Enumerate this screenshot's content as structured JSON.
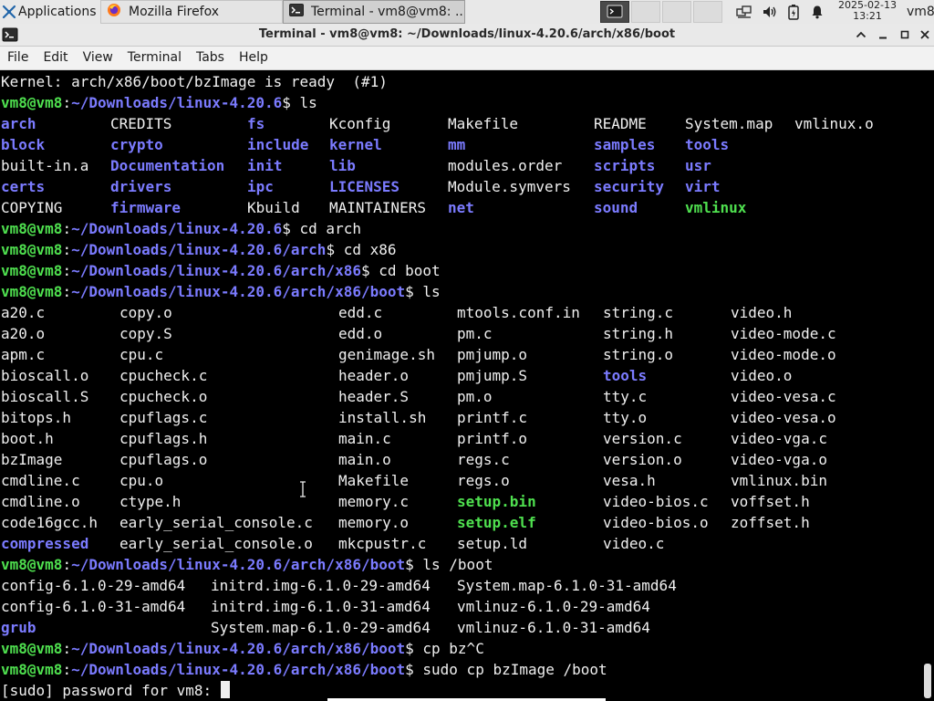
{
  "panel": {
    "apps_label": "Applications",
    "tasks": [
      {
        "label": "Mozilla Firefox"
      },
      {
        "label": "Terminal - vm8@vm8: ..."
      }
    ],
    "clock_date": "2025-02-13",
    "clock_time": "13:21",
    "user": "vm8"
  },
  "window": {
    "title": "Terminal - vm8@vm8: ~/Downloads/linux-4.20.6/arch/x86/boot"
  },
  "menubar": [
    "File",
    "Edit",
    "View",
    "Terminal",
    "Tabs",
    "Help"
  ],
  "terminal": {
    "lines": [
      {
        "segments": [
          {
            "t": "Kernel: arch/x86/boot/bzImage is ready  (#1)",
            "s": ""
          }
        ]
      },
      {
        "segments": [
          {
            "t": "vm8@vm8",
            "s": "g"
          },
          {
            "t": ":",
            "s": ""
          },
          {
            "t": "~/Downloads/linux-4.20.6",
            "s": "b"
          },
          {
            "t": "$ ls",
            "s": ""
          }
        ]
      },
      {
        "cols": [
          [
            0,
            "arch",
            "b"
          ],
          [
            120,
            "CREDITS",
            ""
          ],
          [
            270,
            "fs",
            "b"
          ],
          [
            360,
            "Kconfig",
            ""
          ],
          [
            490,
            "Makefile",
            ""
          ],
          [
            650,
            "README",
            ""
          ],
          [
            750,
            "System.map",
            ""
          ],
          [
            870,
            "vmlinux.o",
            ""
          ]
        ]
      },
      {
        "cols": [
          [
            0,
            "block",
            "b"
          ],
          [
            120,
            "crypto",
            "b"
          ],
          [
            270,
            "include",
            "b"
          ],
          [
            360,
            "kernel",
            "b"
          ],
          [
            490,
            "mm",
            "b"
          ],
          [
            650,
            "samples",
            "b"
          ],
          [
            750,
            "tools",
            "b"
          ]
        ]
      },
      {
        "cols": [
          [
            0,
            "built-in.a",
            ""
          ],
          [
            120,
            "Documentation",
            "b"
          ],
          [
            270,
            "init",
            "b"
          ],
          [
            360,
            "lib",
            "b"
          ],
          [
            490,
            "modules.order",
            ""
          ],
          [
            650,
            "scripts",
            "b"
          ],
          [
            750,
            "usr",
            "b"
          ]
        ]
      },
      {
        "cols": [
          [
            0,
            "certs",
            "b"
          ],
          [
            120,
            "drivers",
            "b"
          ],
          [
            270,
            "ipc",
            "b"
          ],
          [
            360,
            "LICENSES",
            "b"
          ],
          [
            490,
            "Module.symvers",
            ""
          ],
          [
            650,
            "security",
            "b"
          ],
          [
            750,
            "virt",
            "b"
          ]
        ]
      },
      {
        "cols": [
          [
            0,
            "COPYING",
            ""
          ],
          [
            120,
            "firmware",
            "b"
          ],
          [
            270,
            "Kbuild",
            ""
          ],
          [
            360,
            "MAINTAINERS",
            ""
          ],
          [
            490,
            "net",
            "b"
          ],
          [
            650,
            "sound",
            "b"
          ],
          [
            750,
            "vmlinux",
            "g"
          ]
        ]
      },
      {
        "segments": [
          {
            "t": "vm8@vm8",
            "s": "g"
          },
          {
            "t": ":",
            "s": ""
          },
          {
            "t": "~/Downloads/linux-4.20.6",
            "s": "b"
          },
          {
            "t": "$ cd arch",
            "s": ""
          }
        ]
      },
      {
        "segments": [
          {
            "t": "vm8@vm8",
            "s": "g"
          },
          {
            "t": ":",
            "s": ""
          },
          {
            "t": "~/Downloads/linux-4.20.6/arch",
            "s": "b"
          },
          {
            "t": "$ cd x86",
            "s": ""
          }
        ]
      },
      {
        "segments": [
          {
            "t": "vm8@vm8",
            "s": "g"
          },
          {
            "t": ":",
            "s": ""
          },
          {
            "t": "~/Downloads/linux-4.20.6/arch/x86",
            "s": "b"
          },
          {
            "t": "$ cd boot",
            "s": ""
          }
        ]
      },
      {
        "segments": [
          {
            "t": "vm8@vm8",
            "s": "g"
          },
          {
            "t": ":",
            "s": ""
          },
          {
            "t": "~/Downloads/linux-4.20.6/arch/x86/boot",
            "s": "b"
          },
          {
            "t": "$ ls",
            "s": ""
          }
        ]
      },
      {
        "cols": [
          [
            0,
            "a20.c",
            ""
          ],
          [
            130,
            "copy.o",
            ""
          ],
          [
            370,
            "edd.c",
            ""
          ],
          [
            500,
            "mtools.conf.in",
            ""
          ],
          [
            660,
            "string.c",
            ""
          ],
          [
            800,
            "video.h",
            ""
          ]
        ]
      },
      {
        "cols": [
          [
            0,
            "a20.o",
            ""
          ],
          [
            130,
            "copy.S",
            ""
          ],
          [
            370,
            "edd.o",
            ""
          ],
          [
            500,
            "pm.c",
            ""
          ],
          [
            660,
            "string.h",
            ""
          ],
          [
            800,
            "video-mode.c",
            ""
          ]
        ]
      },
      {
        "cols": [
          [
            0,
            "apm.c",
            ""
          ],
          [
            130,
            "cpu.c",
            ""
          ],
          [
            370,
            "genimage.sh",
            ""
          ],
          [
            500,
            "pmjump.o",
            ""
          ],
          [
            660,
            "string.o",
            ""
          ],
          [
            800,
            "video-mode.o",
            ""
          ]
        ]
      },
      {
        "cols": [
          [
            0,
            "bioscall.o",
            ""
          ],
          [
            130,
            "cpucheck.c",
            ""
          ],
          [
            370,
            "header.o",
            ""
          ],
          [
            500,
            "pmjump.S",
            ""
          ],
          [
            660,
            "tools",
            "b"
          ],
          [
            800,
            "video.o",
            ""
          ]
        ]
      },
      {
        "cols": [
          [
            0,
            "bioscall.S",
            ""
          ],
          [
            130,
            "cpucheck.o",
            ""
          ],
          [
            370,
            "header.S",
            ""
          ],
          [
            500,
            "pm.o",
            ""
          ],
          [
            660,
            "tty.c",
            ""
          ],
          [
            800,
            "video-vesa.c",
            ""
          ]
        ]
      },
      {
        "cols": [
          [
            0,
            "bitops.h",
            ""
          ],
          [
            130,
            "cpuflags.c",
            ""
          ],
          [
            370,
            "install.sh",
            ""
          ],
          [
            500,
            "printf.c",
            ""
          ],
          [
            660,
            "tty.o",
            ""
          ],
          [
            800,
            "video-vesa.o",
            ""
          ]
        ]
      },
      {
        "cols": [
          [
            0,
            "boot.h",
            ""
          ],
          [
            130,
            "cpuflags.h",
            ""
          ],
          [
            370,
            "main.c",
            ""
          ],
          [
            500,
            "printf.o",
            ""
          ],
          [
            660,
            "version.c",
            ""
          ],
          [
            800,
            "video-vga.c",
            ""
          ]
        ]
      },
      {
        "cols": [
          [
            0,
            "bzImage",
            ""
          ],
          [
            130,
            "cpuflags.o",
            ""
          ],
          [
            370,
            "main.o",
            ""
          ],
          [
            500,
            "regs.c",
            ""
          ],
          [
            660,
            "version.o",
            ""
          ],
          [
            800,
            "video-vga.o",
            ""
          ]
        ]
      },
      {
        "cols": [
          [
            0,
            "cmdline.c",
            ""
          ],
          [
            130,
            "cpu.o",
            ""
          ],
          [
            370,
            "Makefile",
            ""
          ],
          [
            500,
            "regs.o",
            ""
          ],
          [
            660,
            "vesa.h",
            ""
          ],
          [
            800,
            "vmlinux.bin",
            ""
          ]
        ]
      },
      {
        "cols": [
          [
            0,
            "cmdline.o",
            ""
          ],
          [
            130,
            "ctype.h",
            ""
          ],
          [
            370,
            "memory.c",
            ""
          ],
          [
            500,
            "setup.bin",
            "g"
          ],
          [
            660,
            "video-bios.c",
            ""
          ],
          [
            800,
            "voffset.h",
            ""
          ]
        ]
      },
      {
        "cols": [
          [
            0,
            "code16gcc.h",
            ""
          ],
          [
            130,
            "early_serial_console.c",
            ""
          ],
          [
            370,
            "memory.o",
            ""
          ],
          [
            500,
            "setup.elf",
            "g"
          ],
          [
            660,
            "video-bios.o",
            ""
          ],
          [
            800,
            "zoffset.h",
            ""
          ]
        ]
      },
      {
        "cols": [
          [
            0,
            "compressed",
            "b"
          ],
          [
            130,
            "early_serial_console.o",
            ""
          ],
          [
            370,
            "mkcpustr.c",
            ""
          ],
          [
            500,
            "setup.ld",
            ""
          ],
          [
            660,
            "video.c",
            ""
          ]
        ]
      },
      {
        "segments": [
          {
            "t": "vm8@vm8",
            "s": "g"
          },
          {
            "t": ":",
            "s": ""
          },
          {
            "t": "~/Downloads/linux-4.20.6/arch/x86/boot",
            "s": "b"
          },
          {
            "t": "$ ls /boot",
            "s": ""
          }
        ]
      },
      {
        "cols": [
          [
            0,
            "config-6.1.0-29-amd64",
            ""
          ],
          [
            230,
            "initrd.img-6.1.0-29-amd64",
            ""
          ],
          [
            500,
            "System.map-6.1.0-31-amd64",
            ""
          ]
        ]
      },
      {
        "cols": [
          [
            0,
            "config-6.1.0-31-amd64",
            ""
          ],
          [
            230,
            "initrd.img-6.1.0-31-amd64",
            ""
          ],
          [
            500,
            "vmlinuz-6.1.0-29-amd64",
            ""
          ]
        ]
      },
      {
        "cols": [
          [
            0,
            "grub",
            "b"
          ],
          [
            230,
            "System.map-6.1.0-29-amd64",
            ""
          ],
          [
            500,
            "vmlinuz-6.1.0-31-amd64",
            ""
          ]
        ]
      },
      {
        "segments": [
          {
            "t": "vm8@vm8",
            "s": "g"
          },
          {
            "t": ":",
            "s": ""
          },
          {
            "t": "~/Downloads/linux-4.20.6/arch/x86/boot",
            "s": "b"
          },
          {
            "t": "$ cp bz^C",
            "s": ""
          }
        ]
      },
      {
        "segments": [
          {
            "t": "vm8@vm8",
            "s": "g"
          },
          {
            "t": ":",
            "s": ""
          },
          {
            "t": "~/Downloads/linux-4.20.6/arch/x86/boot",
            "s": "b"
          },
          {
            "t": "$ sudo cp bzImage /boot",
            "s": ""
          }
        ]
      },
      {
        "segments": [
          {
            "t": "[sudo] password for vm8: ",
            "s": ""
          }
        ],
        "cursor": true
      }
    ]
  },
  "colors": {
    "prompt_user": "#4fe04f",
    "prompt_path": "#7b7bff",
    "terminal_bg": "#000000",
    "terminal_fg": "#f0f0f0"
  }
}
